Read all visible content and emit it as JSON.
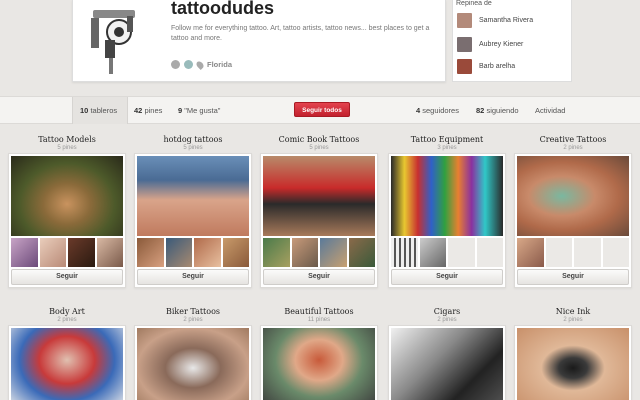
{
  "profile": {
    "name": "tattoodudes",
    "bio": "Follow me for everything tattoo. Art, tattoo artists, tattoo news... best places to get a tattoo and more.",
    "location": "Florida"
  },
  "repins": {
    "title": "Repinea de",
    "users": [
      {
        "name": "Samantha Rivera",
        "color": "#b38a7a"
      },
      {
        "name": "Aubrey Kiener",
        "color": "#7a6e70"
      },
      {
        "name": "Barb arelha",
        "color": "#9a4a3a"
      }
    ]
  },
  "nav": {
    "boards_count": "10",
    "boards_label": "tableros",
    "pins_count": "42",
    "pins_label": "pines",
    "likes_count": "9",
    "likes_label": "\"Me gusta\"",
    "follow_all": "Seguir todos",
    "followers_count": "4",
    "followers_label": "seguidores",
    "following_count": "82",
    "following_label": "siguiendo",
    "activity": "Actividad"
  },
  "follow_label": "Seguir",
  "boards": [
    {
      "title": "Tattoo Models",
      "count": "5 pines"
    },
    {
      "title": "hotdog tattoos",
      "count": "5 pines"
    },
    {
      "title": "Comic Book Tattoos",
      "count": "5 pines"
    },
    {
      "title": "Tattoo Equipment",
      "count": "3 pines"
    },
    {
      "title": "Creative Tattoos",
      "count": "2 pines"
    },
    {
      "title": "Body Art",
      "count": "2 pines"
    },
    {
      "title": "Biker Tattoos",
      "count": "2 pines"
    },
    {
      "title": "Beautiful Tattoos",
      "count": "11 pines"
    },
    {
      "title": "Cigars",
      "count": "2 pines"
    },
    {
      "title": "Nice Ink",
      "count": "2 pines"
    }
  ],
  "colors": {
    "accent": "#cb2d3e",
    "background": "#e9e7e4"
  }
}
